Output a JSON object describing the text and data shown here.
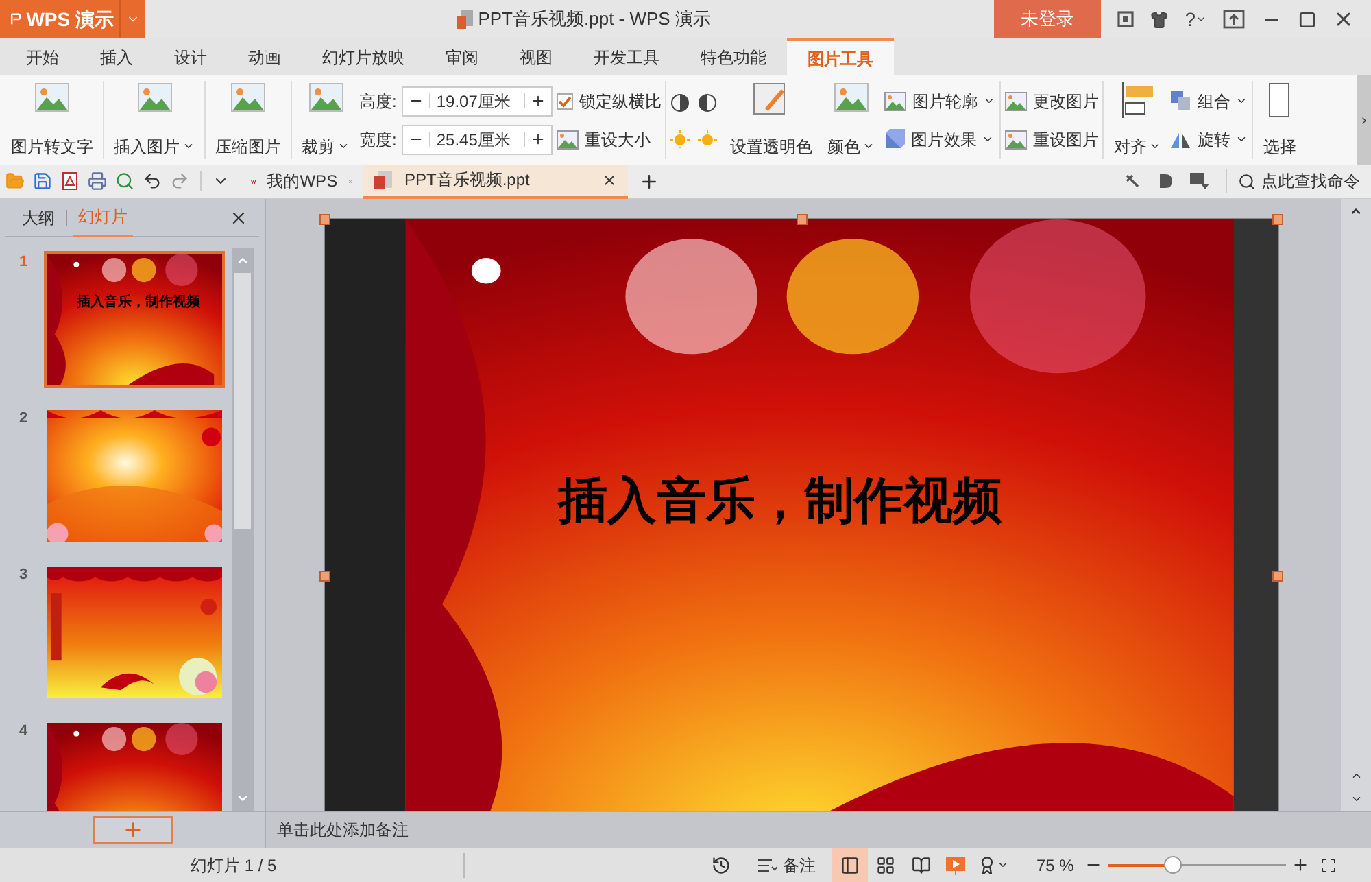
{
  "title_bar": {
    "app_menu": "WPS 演示",
    "title": "PPT音乐视频.ppt - WPS 演示",
    "login": "未登录",
    "help": "?"
  },
  "tabs": [
    {
      "label": "开始",
      "selected": false
    },
    {
      "label": "插入",
      "selected": false
    },
    {
      "label": "设计",
      "selected": false
    },
    {
      "label": "动画",
      "selected": false
    },
    {
      "label": "幻灯片放映",
      "selected": false
    },
    {
      "label": "审阅",
      "selected": false
    },
    {
      "label": "视图",
      "selected": false
    },
    {
      "label": "开发工具",
      "selected": false
    },
    {
      "label": "特色功能",
      "selected": false
    },
    {
      "label": "图片工具",
      "selected": true
    }
  ],
  "ribbon": {
    "to_text": {
      "label": "图片转文字"
    },
    "insert": {
      "label": "插入图片",
      "dropdown": true
    },
    "compress": {
      "label": "压缩图片"
    },
    "crop": {
      "label": "裁剪",
      "dropdown": true
    },
    "height": {
      "label": "高度:",
      "value": "19.07厘米"
    },
    "width": {
      "label": "宽度:",
      "value": "25.45厘米"
    },
    "lock_ratio": {
      "label": "锁定纵横比",
      "checked": true
    },
    "reset_size": {
      "label": "重设大小"
    },
    "transparent": {
      "label": "设置透明色"
    },
    "color": {
      "label": "颜色",
      "dropdown": true
    },
    "outline": {
      "label": "图片轮廓",
      "dropdown": true
    },
    "effect": {
      "label": "图片效果",
      "dropdown": true
    },
    "change": {
      "label": "更改图片"
    },
    "reset": {
      "label": "重设图片"
    },
    "align": {
      "label": "对齐",
      "dropdown": true
    },
    "group": {
      "label": "组合",
      "dropdown": true
    },
    "rotate": {
      "label": "旋转",
      "dropdown": true
    },
    "select": {
      "label": "选择"
    }
  },
  "doc_tabs": [
    {
      "label": "我的WPS",
      "selected": false
    },
    {
      "label": "PPT音乐视频.ppt",
      "selected": true
    }
  ],
  "search": {
    "placeholder": "点此查找命令"
  },
  "panel": {
    "tabs": [
      {
        "label": "大纲",
        "selected": false
      },
      {
        "label": "幻灯片",
        "selected": true
      }
    ],
    "slides": [
      {
        "number": "1",
        "selected": true,
        "title": "插入音乐，制作视频",
        "kind": "fireworks"
      },
      {
        "number": "2",
        "selected": false,
        "kind": "sunburst"
      },
      {
        "number": "3",
        "selected": false,
        "kind": "stage"
      },
      {
        "number": "4",
        "selected": false,
        "kind": "fireworks"
      }
    ]
  },
  "slide": {
    "title": "插入音乐，制作视频"
  },
  "notes": {
    "placeholder": "单击此处添加备注"
  },
  "status_bar": {
    "slide_count": "幻灯片 1 / 5",
    "notes": "备注",
    "views": [
      {
        "kind": "normal",
        "selected": true
      },
      {
        "kind": "sorter",
        "selected": false
      },
      {
        "kind": "reading",
        "selected": false
      }
    ],
    "zoom": "75 %",
    "zoom_slider": {
      "level": 0.36
    }
  }
}
